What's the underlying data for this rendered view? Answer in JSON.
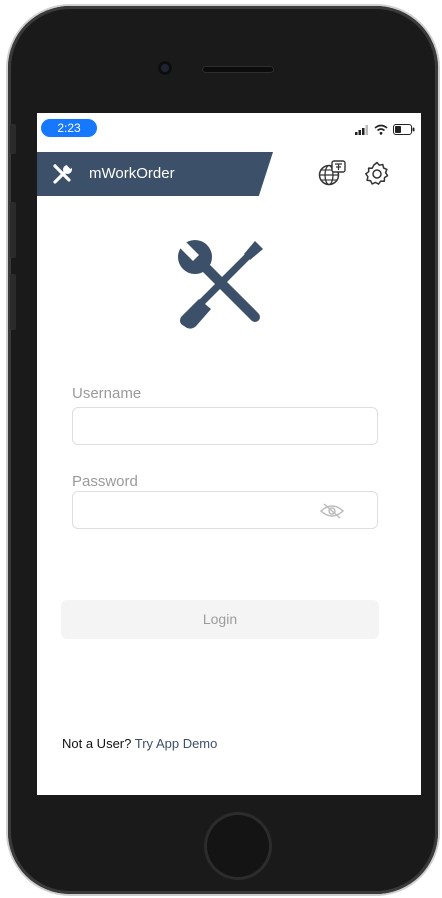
{
  "status_bar": {
    "time": "2:23",
    "icons": [
      "signal-icon",
      "wifi-icon",
      "battery-icon"
    ]
  },
  "header": {
    "app_title": "mWorkOrder",
    "brand_icon": "wrench-screwdriver-icon",
    "language_icon": "globe-icon",
    "settings_icon": "gear-icon",
    "banner_color": "#3c5069"
  },
  "login_form": {
    "username_label": "Username",
    "username_value": "",
    "password_label": "Password",
    "password_value": "",
    "password_visibility_icon": "eye-slash-icon",
    "login_label": "Login"
  },
  "footer": {
    "prompt": "Not a User?",
    "demo_link": "Try App Demo"
  },
  "colors": {
    "brand": "#3c5069",
    "time_pill": "#1677ff"
  }
}
